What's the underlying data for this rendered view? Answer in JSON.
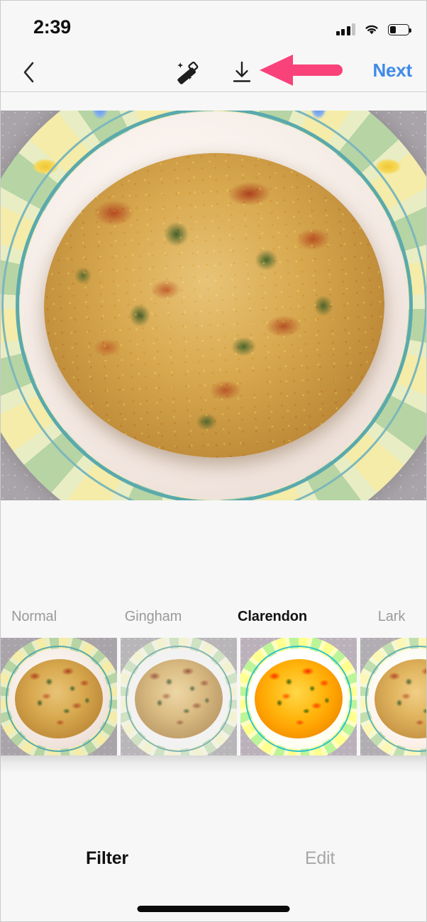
{
  "status_bar": {
    "time": "2:39",
    "cellular_icon": "cellular-signal-icon",
    "cellular_bars_filled": 3,
    "cellular_bars_total": 4,
    "wifi_icon": "wifi-icon",
    "battery_icon": "battery-icon",
    "battery_level_percent": 35
  },
  "nav_bar": {
    "back_icon": "chevron-left-icon",
    "back_label": "‹",
    "magic_icon": "magic-wand-icon",
    "download_icon": "download-icon",
    "next_label": "Next",
    "next_color": "#3f8ae8"
  },
  "annotation": {
    "arrow_icon": "left-pointing-arrow-annotation",
    "color": "#f9427a",
    "points_to": "download-icon"
  },
  "photo": {
    "description": "omelette on decorative floral plate",
    "background_color": "#a9a4a9"
  },
  "filters": {
    "items": [
      {
        "label": "Normal",
        "selected": false
      },
      {
        "label": "Gingham",
        "selected": false
      },
      {
        "label": "Clarendon",
        "selected": true
      },
      {
        "label": "Lark",
        "selected": false
      }
    ],
    "selected_label": "Clarendon"
  },
  "bottom_tabs": {
    "items": [
      {
        "label": "Filter",
        "active": true
      },
      {
        "label": "Edit",
        "active": false
      }
    ]
  },
  "home_indicator": {
    "name": "home-indicator"
  }
}
